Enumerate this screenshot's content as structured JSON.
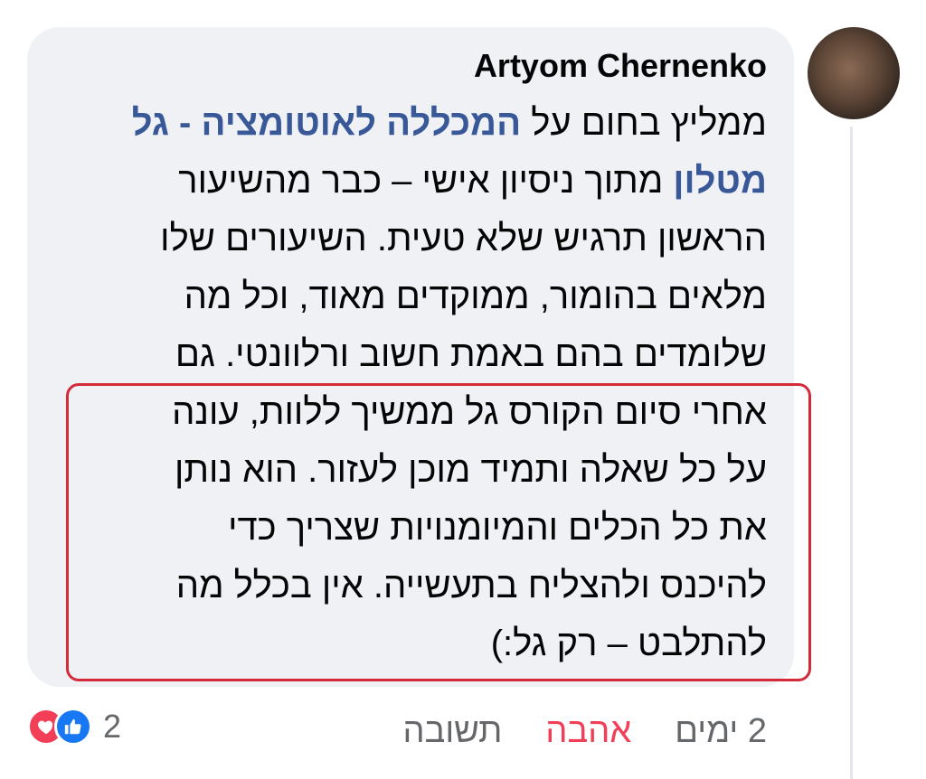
{
  "comment": {
    "author": "Artyom Chernenko",
    "lines": [
      {
        "before": "ממליץ בחום על ",
        "link": "המכללה לאוטומציה - גל",
        "after": ""
      },
      {
        "before": "",
        "link": "מטלון",
        "after": "  מתוך ניסיון אישי – כבר מהשיעור"
      },
      {
        "before": "הראשון תרגיש שלא טעית. השיעורים שלו",
        "link": "",
        "after": ""
      },
      {
        "before": "מלאים בהומור, ממוקדים מאוד, וכל מה",
        "link": "",
        "after": ""
      },
      {
        "before": "שלומדים בהם באמת חשוב ורלוונטי. גם",
        "link": "",
        "after": ""
      },
      {
        "before": "אחרי סיום הקורס גל ממשיך ללוות, עונה",
        "link": "",
        "after": ""
      },
      {
        "before": "על כל שאלה ותמיד מוכן לעזור. הוא נותן",
        "link": "",
        "after": ""
      },
      {
        "before": "את כל הכלים והמיומנויות שצריך כדי",
        "link": "",
        "after": ""
      },
      {
        "before": "להיכנס ולהצליח בתעשייה. אין בכלל מה",
        "link": "",
        "after": ""
      },
      {
        "before": "להתלבט – רק גל:)",
        "link": "",
        "after": ""
      }
    ]
  },
  "reactions": {
    "count": "2",
    "types": [
      "love-icon",
      "like-icon"
    ],
    "colors": {
      "love": "#f33e58",
      "like": "#1877f2"
    }
  },
  "actions": {
    "time": "2 ימים",
    "love": "אהבה",
    "reply": "תשובה"
  },
  "highlight_color": "#d42b3a"
}
